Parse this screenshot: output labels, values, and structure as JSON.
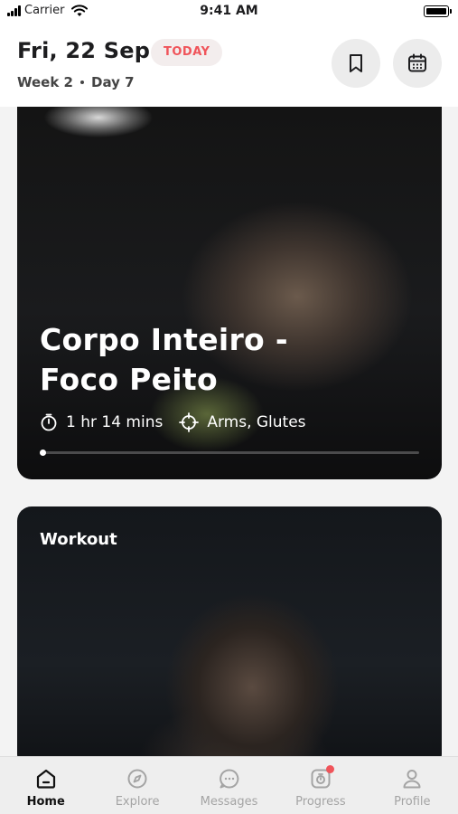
{
  "status_bar": {
    "carrier": "Carrier",
    "time": "9:41 AM"
  },
  "header": {
    "date": "Fri, 22 Sep",
    "badge": "TODAY",
    "week": "Week 2",
    "day": "Day 7",
    "actions": [
      {
        "icon": "bookmark-icon"
      },
      {
        "icon": "calendar-icon"
      }
    ]
  },
  "cards": [
    {
      "title_line1": "Corpo Inteiro -",
      "title_line2": "Foco Peito",
      "duration": "1 hr 14 mins",
      "focus": "Arms, Glutes",
      "progress": 0.0
    },
    {
      "label": "Workout"
    }
  ],
  "tabbar": {
    "active": "Home",
    "items": [
      {
        "label": "Home",
        "icon": "home-icon"
      },
      {
        "label": "Explore",
        "icon": "compass-icon"
      },
      {
        "label": "Messages",
        "icon": "chat-icon"
      },
      {
        "label": "Progress",
        "icon": "progress-icon",
        "notification": true
      },
      {
        "label": "Profile",
        "icon": "profile-icon"
      }
    ]
  },
  "colors": {
    "accent": "#f0545a",
    "badge_bg": "#f3eded"
  }
}
